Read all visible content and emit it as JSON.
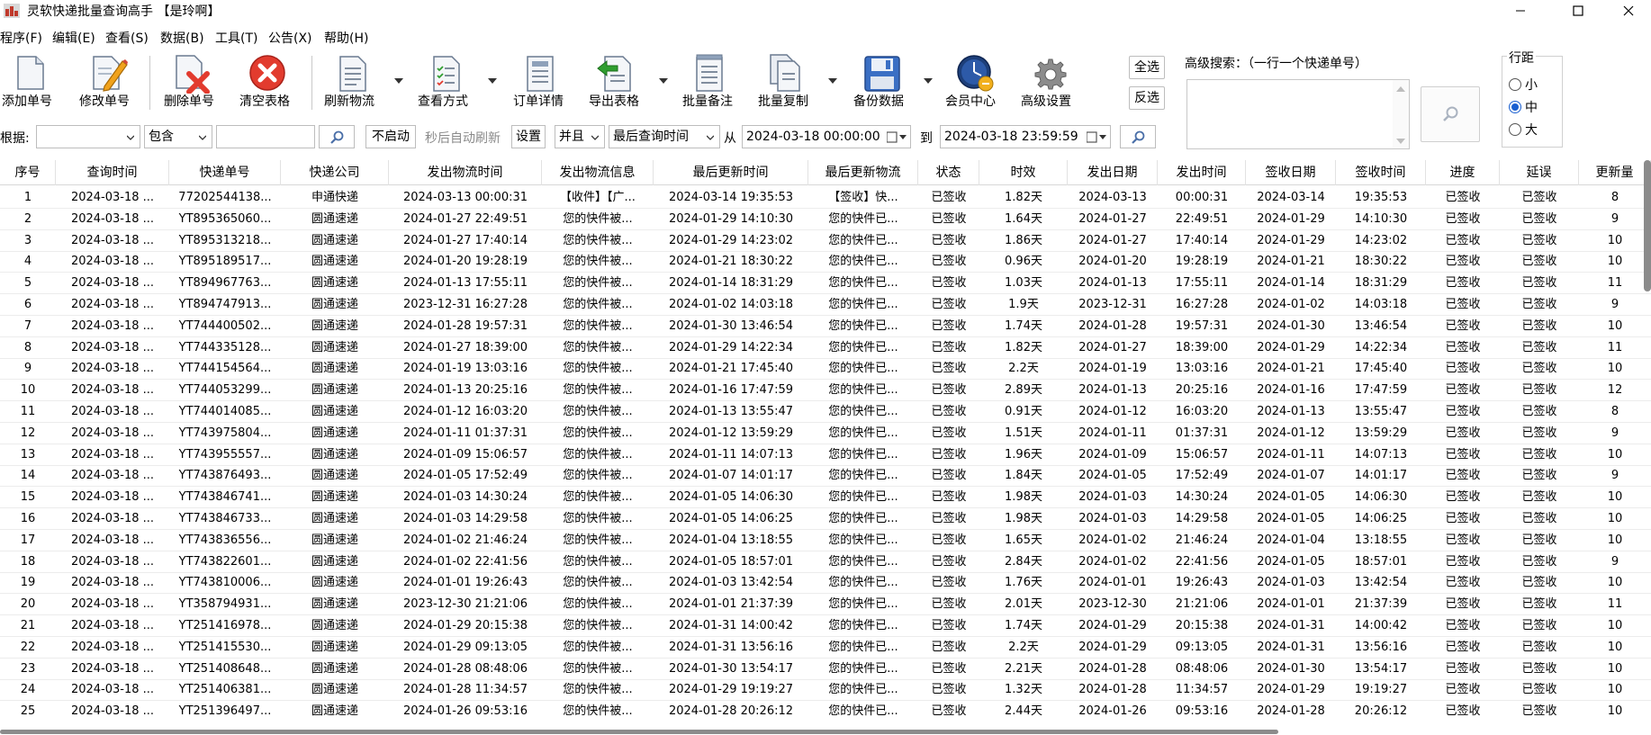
{
  "window": {
    "title": "灵软快递批量查询高手 【是玲啊】"
  },
  "menu": [
    "程序(F)",
    "编辑(E)",
    "查看(S)",
    "数据(B)",
    "工具(T)",
    "公告(X)",
    "帮助(H)"
  ],
  "toolbar": {
    "add": "添加单号",
    "edit": "修改单号",
    "delete": "删除单号",
    "clear": "清空表格",
    "refresh": "刷新物流",
    "view": "查看方式",
    "order": "订单详情",
    "export": "导出表格",
    "note": "批量备注",
    "copy": "批量复制",
    "backup": "备份数据",
    "member": "会员中心",
    "settings": "高级设置",
    "select_all": "全选",
    "invert": "反选"
  },
  "advanced": {
    "label": "高级搜索：（一行一个快递单号）"
  },
  "row_spacing": {
    "title": "行距",
    "options": [
      "小",
      "中",
      "大"
    ],
    "selected": "中"
  },
  "filter": {
    "label": "根据:",
    "field_value": "",
    "mode_value": "包含",
    "keyword": "",
    "auto_start": "不启动",
    "auto_refresh_text": "秒后自动刷新",
    "set_button": "设置",
    "logic_value": "并且",
    "time_field_value": "最后查询时间",
    "from_label": "从",
    "from_value": "2024-03-18 00:00:00",
    "to_label": "到",
    "to_value": "2024-03-18 23:59:59"
  },
  "table": {
    "columns": [
      "序号",
      "查询时间",
      "快递单号",
      "快递公司",
      "发出物流时间",
      "发出物流信息",
      "最后更新时间",
      "最后更新物流",
      "状态",
      "时效",
      "发出日期",
      "发出时间",
      "签收日期",
      "签收时间",
      "进度",
      "延误",
      "更新量"
    ],
    "rows": [
      [
        "1",
        "2024-03-18 ...",
        "77202544138...",
        "申通快递",
        "2024-03-13 00:00:31",
        "【收件】【广...",
        "2024-03-14 19:35:53",
        "【签收】快...",
        "已签收",
        "1.82天",
        "2024-03-13",
        "00:00:31",
        "2024-03-14",
        "19:35:53",
        "已签收",
        "已签收",
        "8"
      ],
      [
        "2",
        "2024-03-18 ...",
        "YT895365060...",
        "圆通速递",
        "2024-01-27 22:49:51",
        "您的快件被...",
        "2024-01-29 14:10:30",
        "您的快件已...",
        "已签收",
        "1.64天",
        "2024-01-27",
        "22:49:51",
        "2024-01-29",
        "14:10:30",
        "已签收",
        "已签收",
        "9"
      ],
      [
        "3",
        "2024-03-18 ...",
        "YT895313218...",
        "圆通速递",
        "2024-01-27 17:40:14",
        "您的快件被...",
        "2024-01-29 14:23:02",
        "您的快件已...",
        "已签收",
        "1.86天",
        "2024-01-27",
        "17:40:14",
        "2024-01-29",
        "14:23:02",
        "已签收",
        "已签收",
        "10"
      ],
      [
        "4",
        "2024-03-18 ...",
        "YT895189517...",
        "圆通速递",
        "2024-01-20 19:28:19",
        "您的快件被...",
        "2024-01-21 18:30:22",
        "您的快件已...",
        "已签收",
        "0.96天",
        "2024-01-20",
        "19:28:19",
        "2024-01-21",
        "18:30:22",
        "已签收",
        "已签收",
        "10"
      ],
      [
        "5",
        "2024-03-18 ...",
        "YT894967763...",
        "圆通速递",
        "2024-01-13 17:55:11",
        "您的快件被...",
        "2024-01-14 18:31:29",
        "您的快件已...",
        "已签收",
        "1.03天",
        "2024-01-13",
        "17:55:11",
        "2024-01-14",
        "18:31:29",
        "已签收",
        "已签收",
        "11"
      ],
      [
        "6",
        "2024-03-18 ...",
        "YT894747913...",
        "圆通速递",
        "2023-12-31 16:27:28",
        "您的快件被...",
        "2024-01-02 14:03:18",
        "您的快件已...",
        "已签收",
        "1.9天",
        "2023-12-31",
        "16:27:28",
        "2024-01-02",
        "14:03:18",
        "已签收",
        "已签收",
        "9"
      ],
      [
        "7",
        "2024-03-18 ...",
        "YT744400502...",
        "圆通速递",
        "2024-01-28 19:57:31",
        "您的快件被...",
        "2024-01-30 13:46:54",
        "您的快件已...",
        "已签收",
        "1.74天",
        "2024-01-28",
        "19:57:31",
        "2024-01-30",
        "13:46:54",
        "已签收",
        "已签收",
        "10"
      ],
      [
        "8",
        "2024-03-18 ...",
        "YT744335128...",
        "圆通速递",
        "2024-01-27 18:39:00",
        "您的快件被...",
        "2024-01-29 14:22:34",
        "您的快件已...",
        "已签收",
        "1.82天",
        "2024-01-27",
        "18:39:00",
        "2024-01-29",
        "14:22:34",
        "已签收",
        "已签收",
        "11"
      ],
      [
        "9",
        "2024-03-18 ...",
        "YT744154564...",
        "圆通速递",
        "2024-01-19 13:03:16",
        "您的快件被...",
        "2024-01-21 17:45:40",
        "您的快件已...",
        "已签收",
        "2.2天",
        "2024-01-19",
        "13:03:16",
        "2024-01-21",
        "17:45:40",
        "已签收",
        "已签收",
        "10"
      ],
      [
        "10",
        "2024-03-18 ...",
        "YT744053299...",
        "圆通速递",
        "2024-01-13 20:25:16",
        "您的快件被...",
        "2024-01-16 17:47:59",
        "您的快件已...",
        "已签收",
        "2.89天",
        "2024-01-13",
        "20:25:16",
        "2024-01-16",
        "17:47:59",
        "已签收",
        "已签收",
        "12"
      ],
      [
        "11",
        "2024-03-18 ...",
        "YT744014085...",
        "圆通速递",
        "2024-01-12 16:03:20",
        "您的快件被...",
        "2024-01-13 13:55:47",
        "您的快件已...",
        "已签收",
        "0.91天",
        "2024-01-12",
        "16:03:20",
        "2024-01-13",
        "13:55:47",
        "已签收",
        "已签收",
        "8"
      ],
      [
        "12",
        "2024-03-18 ...",
        "YT743975804...",
        "圆通速递",
        "2024-01-11 01:37:31",
        "您的快件被...",
        "2024-01-12 13:59:29",
        "您的快件已...",
        "已签收",
        "1.51天",
        "2024-01-11",
        "01:37:31",
        "2024-01-12",
        "13:59:29",
        "已签收",
        "已签收",
        "9"
      ],
      [
        "13",
        "2024-03-18 ...",
        "YT743955557...",
        "圆通速递",
        "2024-01-09 15:06:57",
        "您的快件被...",
        "2024-01-11 14:07:13",
        "您的快件已...",
        "已签收",
        "1.96天",
        "2024-01-09",
        "15:06:57",
        "2024-01-11",
        "14:07:13",
        "已签收",
        "已签收",
        "10"
      ],
      [
        "14",
        "2024-03-18 ...",
        "YT743876493...",
        "圆通速递",
        "2024-01-05 17:52:49",
        "您的快件被...",
        "2024-01-07 14:01:17",
        "您的快件已...",
        "已签收",
        "1.84天",
        "2024-01-05",
        "17:52:49",
        "2024-01-07",
        "14:01:17",
        "已签收",
        "已签收",
        "9"
      ],
      [
        "15",
        "2024-03-18 ...",
        "YT743846741...",
        "圆通速递",
        "2024-01-03 14:30:24",
        "您的快件被...",
        "2024-01-05 14:06:30",
        "您的快件已...",
        "已签收",
        "1.98天",
        "2024-01-03",
        "14:30:24",
        "2024-01-05",
        "14:06:30",
        "已签收",
        "已签收",
        "10"
      ],
      [
        "16",
        "2024-03-18 ...",
        "YT743846733...",
        "圆通速递",
        "2024-01-03 14:29:58",
        "您的快件被...",
        "2024-01-05 14:06:25",
        "您的快件已...",
        "已签收",
        "1.98天",
        "2024-01-03",
        "14:29:58",
        "2024-01-05",
        "14:06:25",
        "已签收",
        "已签收",
        "10"
      ],
      [
        "17",
        "2024-03-18 ...",
        "YT743836556...",
        "圆通速递",
        "2024-01-02 21:46:24",
        "您的快件被...",
        "2024-01-04 13:18:55",
        "您的快件已...",
        "已签收",
        "1.65天",
        "2024-01-02",
        "21:46:24",
        "2024-01-04",
        "13:18:55",
        "已签收",
        "已签收",
        "10"
      ],
      [
        "18",
        "2024-03-18 ...",
        "YT743822601...",
        "圆通速递",
        "2024-01-02 22:41:56",
        "您的快件被...",
        "2024-01-05 18:57:01",
        "您的快件已...",
        "已签收",
        "2.84天",
        "2024-01-02",
        "22:41:56",
        "2024-01-05",
        "18:57:01",
        "已签收",
        "已签收",
        "9"
      ],
      [
        "19",
        "2024-03-18 ...",
        "YT743810006...",
        "圆通速递",
        "2024-01-01 19:26:43",
        "您的快件被...",
        "2024-01-03 13:42:54",
        "您的快件已...",
        "已签收",
        "1.76天",
        "2024-01-01",
        "19:26:43",
        "2024-01-03",
        "13:42:54",
        "已签收",
        "已签收",
        "10"
      ],
      [
        "20",
        "2024-03-18 ...",
        "YT358794931...",
        "圆通速递",
        "2023-12-30 21:21:06",
        "您的快件被...",
        "2024-01-01 21:37:39",
        "您的快件已...",
        "已签收",
        "2.01天",
        "2023-12-30",
        "21:21:06",
        "2024-01-01",
        "21:37:39",
        "已签收",
        "已签收",
        "11"
      ],
      [
        "21",
        "2024-03-18 ...",
        "YT251416978...",
        "圆通速递",
        "2024-01-29 20:15:38",
        "您的快件被...",
        "2024-01-31 14:00:42",
        "您的快件已...",
        "已签收",
        "1.74天",
        "2024-01-29",
        "20:15:38",
        "2024-01-31",
        "14:00:42",
        "已签收",
        "已签收",
        "10"
      ],
      [
        "22",
        "2024-03-18 ...",
        "YT251415530...",
        "圆通速递",
        "2024-01-29 09:13:05",
        "您的快件被...",
        "2024-01-31 13:56:16",
        "您的快件已...",
        "已签收",
        "2.2天",
        "2024-01-29",
        "09:13:05",
        "2024-01-31",
        "13:56:16",
        "已签收",
        "已签收",
        "10"
      ],
      [
        "23",
        "2024-03-18 ...",
        "YT251408648...",
        "圆通速递",
        "2024-01-28 08:48:06",
        "您的快件被...",
        "2024-01-30 13:54:17",
        "您的快件已...",
        "已签收",
        "2.21天",
        "2024-01-28",
        "08:48:06",
        "2024-01-30",
        "13:54:17",
        "已签收",
        "已签收",
        "10"
      ],
      [
        "24",
        "2024-03-18 ...",
        "YT251406381...",
        "圆通速递",
        "2024-01-28 11:34:57",
        "您的快件被...",
        "2024-01-29 19:19:27",
        "您的快件已...",
        "已签收",
        "1.32天",
        "2024-01-28",
        "11:34:57",
        "2024-01-29",
        "19:19:27",
        "已签收",
        "已签收",
        "10"
      ],
      [
        "25",
        "2024-03-18 ...",
        "YT251396497...",
        "圆通速递",
        "2024-01-26 09:53:16",
        "您的快件被...",
        "2024-01-28 20:26:12",
        "您的快件已...",
        "已签收",
        "2.44天",
        "2024-01-26",
        "09:53:16",
        "2024-01-28",
        "20:26:12",
        "已签收",
        "已签收",
        "10"
      ]
    ]
  },
  "colors": {
    "accent": "#1a5fd0",
    "delete": "#e23b2e",
    "export": "#2f9e2f"
  }
}
